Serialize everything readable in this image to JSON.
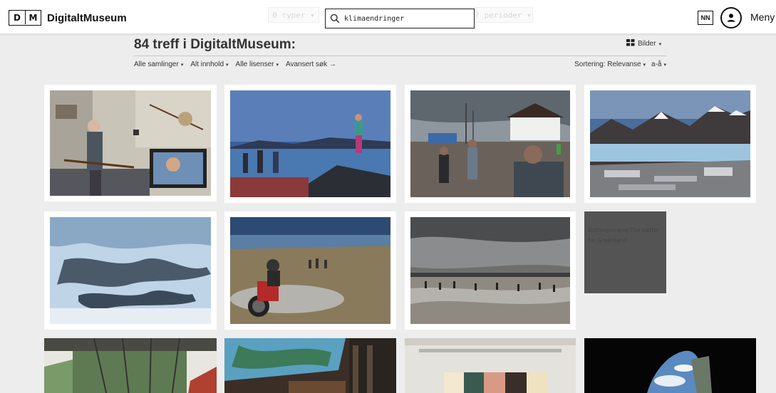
{
  "header": {
    "logo_letters": [
      "D",
      "M"
    ],
    "site_name": "DigitaltMuseum",
    "type_filter": "0 typer ▾",
    "period_filter": "? perioder ▾",
    "search_value": "klimaendringer",
    "language": "NN",
    "menu_label": "Meny"
  },
  "results": {
    "title": "84 treff i DigitaltMuseum:",
    "view_label": "Bilder",
    "filters": [
      "Alle samlinger",
      "Alt innhold",
      "Alle lisenser"
    ],
    "advanced_search": "Avansert søk →",
    "sorting_label": "Sortering: Relevanse",
    "sort_order": "a-å"
  },
  "grid": {
    "placeholder_title": "Anthropocene/The battle for Greenland"
  },
  "colors": {
    "page_bg": "#ededed",
    "placeholder_bg": "#545454",
    "text_dark": "#333333"
  }
}
